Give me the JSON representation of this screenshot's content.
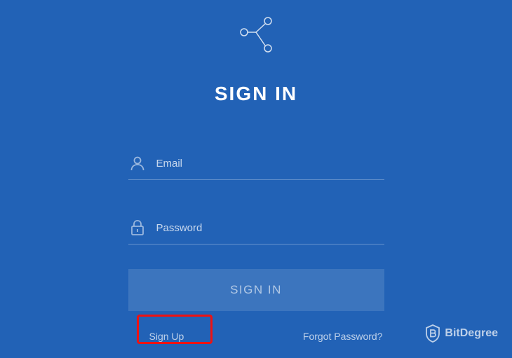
{
  "title": "SIGN IN",
  "form": {
    "email_placeholder": "Email",
    "password_placeholder": "Password",
    "submit_label": "SIGN IN"
  },
  "links": {
    "signup": "Sign Up",
    "forgot": "Forgot Password?"
  },
  "watermark": {
    "label": "BitDegree"
  }
}
